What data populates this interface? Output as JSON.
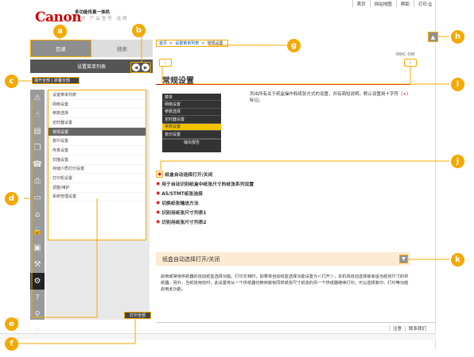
{
  "header": {
    "logo": "Canon",
    "product_name": "多功能传真一体机",
    "product_sub": "系列 产品型号 说明",
    "links": [
      "首页",
      "网站地图",
      "帮助",
      "打印"
    ]
  },
  "left": {
    "tab_contents": "目录",
    "tab_search": "搜索",
    "settings_title": "设置菜单列表",
    "expand_collapse": "展开全部 | 折叠全部",
    "tree_items": [
      "设置菜单列表",
      "网络设置",
      "参数选择",
      "定时器设置",
      "常规设置",
      "复印设置",
      "传真设置",
      "扫描设置",
      "存储介质打印设置",
      "打印机设置",
      "调整/维护",
      "系统管理设置"
    ],
    "current_index": 4,
    "print_all": "打印全部"
  },
  "main": {
    "breadcrumb": [
      "首页",
      "设置菜单列表",
      "常规设置"
    ],
    "code": "0RKC-09E",
    "title": "常规设置",
    "panel_header": "菜单",
    "panel_rows": [
      "网络设置",
      "参数选择",
      "定时器设置",
      "常规设置",
      "复印设置"
    ],
    "panel_selected": 3,
    "panel_footer": "输出报告",
    "description_a": "列出所有关于纸盒操作和纸张方式的设置，并有简短说明。默认设置用十字符（",
    "description_mark": "+",
    "description_b": "）标记。",
    "links": [
      "纸盒自动选择打开/关闭",
      "用于自动识别纸盒中纸张尺寸的纸张系列设置",
      "A5/STMT纸张选择",
      "切换纸张输送方法",
      "识别用纸张尺寸列表1",
      "识别用纸张尺寸列表2"
    ],
    "section_title": "纸盒自动选择打开/关闭",
    "body_text": "启用或禁用供纸器的自动纸盒选择功能。打印文档时，如果将自动纸盒选择功能设置为＜打开＞，本机将自动选择装有适当纸张尺寸的供纸器。另外，当纸张用完时，此设置将从一个供纸器切换到装有同样纸张尺寸纸张的另一个供纸器继续打印。可以选择复印、打印等功能启用此功能。"
  },
  "footer": {
    "links": [
      "注意",
      "联系我们"
    ]
  },
  "callouts": [
    "a",
    "b",
    "c",
    "d",
    "e",
    "f",
    "g",
    "h",
    "i",
    "j",
    "k"
  ],
  "colors": {
    "accent": "#f4a900",
    "brand_red": "#cc0000",
    "link_blue": "#00479d"
  }
}
